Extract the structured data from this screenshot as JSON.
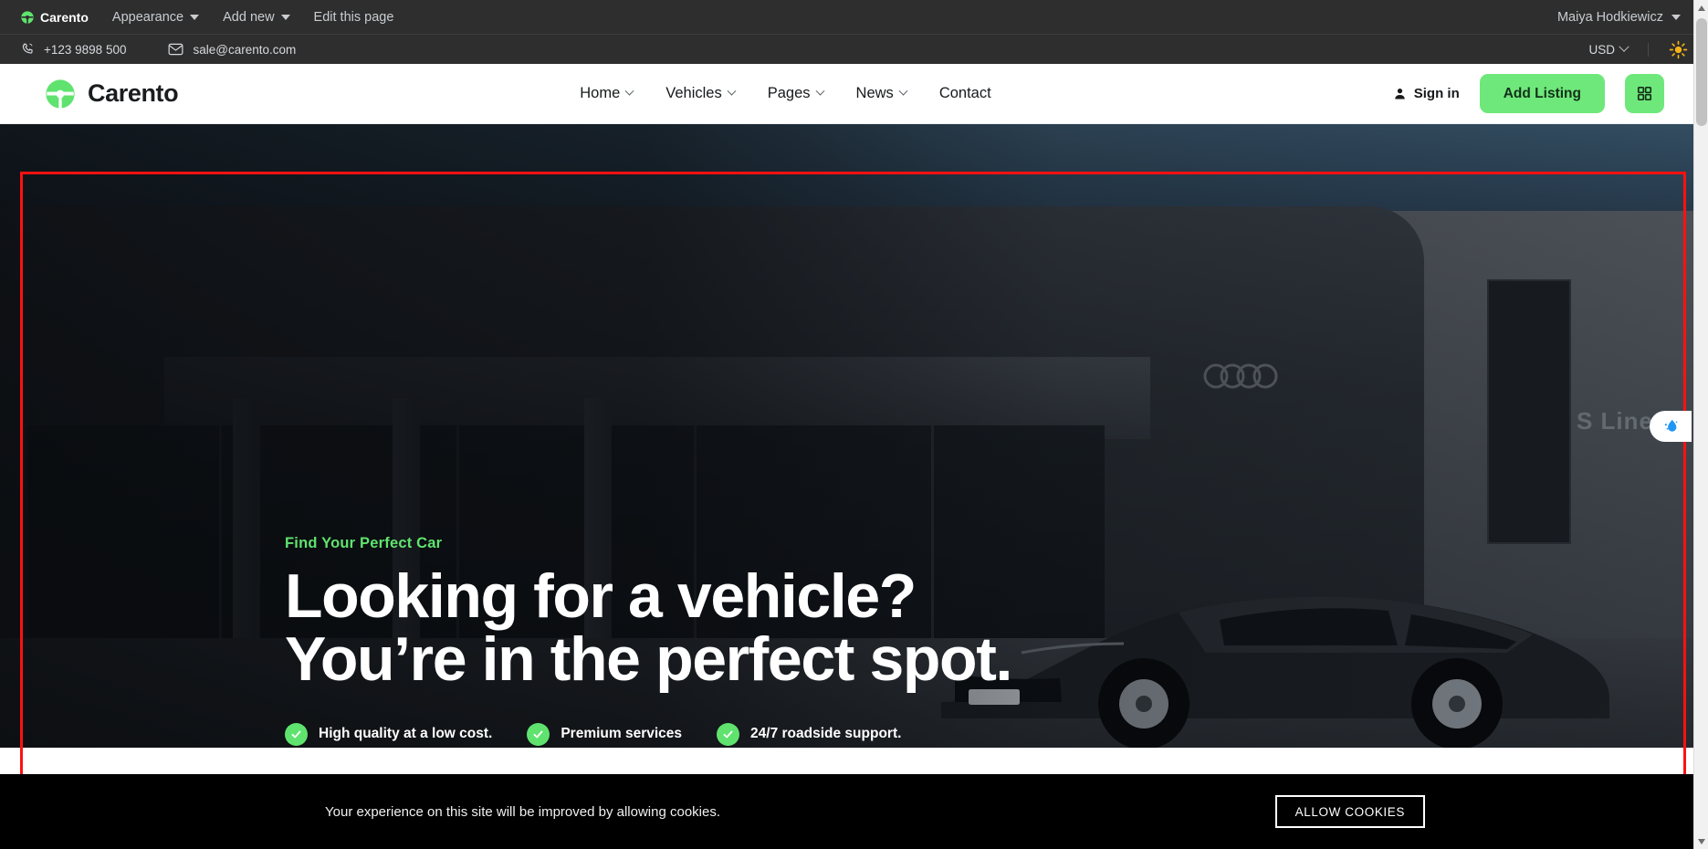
{
  "adminbar": {
    "brand": "Carento",
    "items": [
      {
        "label": "Appearance",
        "has_caret": true
      },
      {
        "label": "Add new",
        "has_caret": true
      },
      {
        "label": "Edit this page",
        "has_caret": false
      }
    ],
    "user": "Maiya Hodkiewicz"
  },
  "topbar": {
    "phone": "+123 9898 500",
    "email": "sale@carento.com",
    "currency": "USD",
    "theme_icon": "sun-icon"
  },
  "header": {
    "logo_text": "Carento",
    "nav": [
      {
        "label": "Home",
        "has_chevron": true
      },
      {
        "label": "Vehicles",
        "has_chevron": true
      },
      {
        "label": "Pages",
        "has_chevron": true
      },
      {
        "label": "News",
        "has_chevron": true
      },
      {
        "label": "Contact",
        "has_chevron": false
      }
    ],
    "sign_in": "Sign in",
    "add_listing": "Add Listing",
    "grid_icon": "grid-icon"
  },
  "hero": {
    "eyebrow": "Find Your Perfect Car",
    "headline_line1": "Looking for a vehicle?",
    "headline_line2": "You’re in the perfect spot.",
    "features": [
      "High quality at a low cost.",
      "Premium services",
      "24/7 roadside support."
    ],
    "badge_text": "S Line"
  },
  "cookies": {
    "message": "Your experience on this site will be improved by allowing cookies.",
    "button": "ALLOW COOKIES"
  },
  "colors": {
    "accent_green": "#6ee87a",
    "eyebrow_green": "#5fe36e",
    "admin_bg": "#2e2e2e",
    "selection_red": "#ff1111",
    "cookie_bg": "#000000"
  }
}
